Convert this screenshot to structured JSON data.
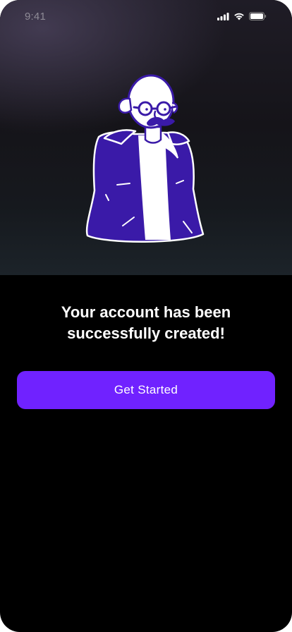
{
  "status_bar": {
    "time": "9:41",
    "icons": [
      "cellular-signal-icon",
      "wifi-icon",
      "battery-icon"
    ]
  },
  "hero": {
    "illustration": "bald-man-glasses-mustache-purple-jacket"
  },
  "message": {
    "title": "Your account has been\nsuccessfully created!"
  },
  "actions": {
    "get_started_label": "Get Started"
  },
  "colors": {
    "background": "#000000",
    "accent": "#7022ff",
    "illustration_purple": "#3a1aa8",
    "text": "#ffffff"
  }
}
